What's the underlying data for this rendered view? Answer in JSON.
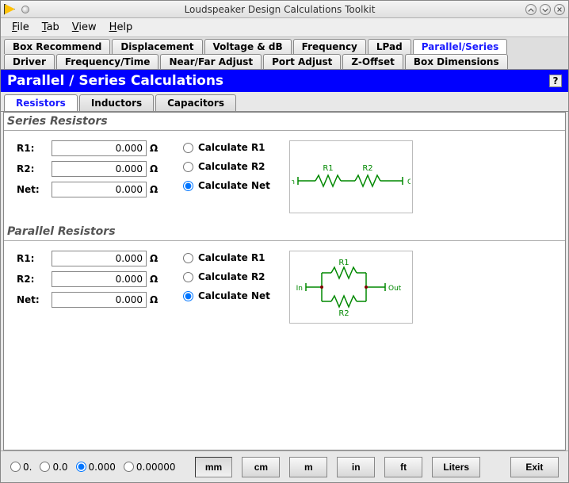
{
  "window": {
    "title": "Loudspeaker Design Calculations Toolkit"
  },
  "menubar": [
    {
      "label": "File",
      "u": 0
    },
    {
      "label": "Tab",
      "u": 0
    },
    {
      "label": "View",
      "u": 0
    },
    {
      "label": "Help",
      "u": 0
    }
  ],
  "tabs_row1": [
    "Box Recommend",
    "Displacement",
    "Voltage & dB",
    "Frequency",
    "LPad",
    "Parallel/Series"
  ],
  "tabs_row1_active": 5,
  "tabs_row2": [
    "Driver",
    "Frequency/Time",
    "Near/Far Adjust",
    "Port Adjust",
    "Z-Offset",
    "Box Dimensions"
  ],
  "panel": {
    "title": "Parallel / Series Calculations",
    "help": "?"
  },
  "subtabs": [
    "Resistors",
    "Inductors",
    "Capacitors"
  ],
  "subtabs_active": 0,
  "series": {
    "title": "Series Resistors",
    "r1_label": "R1:",
    "r1_value": "0.000",
    "r1_unit": "Ω",
    "r2_label": "R2:",
    "r2_value": "0.000",
    "r2_unit": "Ω",
    "net_label": "Net:",
    "net_value": "0.000",
    "net_unit": "Ω",
    "calc_r1": "Calculate R1",
    "calc_r2": "Calculate R2",
    "calc_net": "Calculate Net",
    "selected": "net",
    "diag": {
      "in": "In",
      "out": "Out",
      "r1": "R1",
      "r2": "R2"
    }
  },
  "parallel": {
    "title": "Parallel Resistors",
    "r1_label": "R1:",
    "r1_value": "0.000",
    "r1_unit": "Ω",
    "r2_label": "R2:",
    "r2_value": "0.000",
    "r2_unit": "Ω",
    "net_label": "Net:",
    "net_value": "0.000",
    "net_unit": "Ω",
    "calc_r1": "Calculate R1",
    "calc_r2": "Calculate R2",
    "calc_net": "Calculate Net",
    "selected": "net",
    "diag": {
      "in": "In",
      "out": "Out",
      "r1": "R1",
      "r2": "R2"
    }
  },
  "footer": {
    "precision": [
      "0.",
      "0.0",
      "0.000",
      "0.00000"
    ],
    "precision_selected": 2,
    "units": [
      "mm",
      "cm",
      "m",
      "in",
      "ft",
      "Liters"
    ],
    "unit_selected": 0,
    "exit": "Exit"
  }
}
